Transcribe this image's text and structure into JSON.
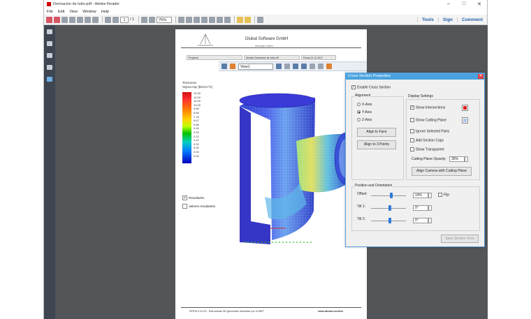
{
  "window": {
    "title": "Derivacion de tubo.pdf - Adobe Reader"
  },
  "menu": [
    "File",
    "Edit",
    "View",
    "Window",
    "Help"
  ],
  "toolbar": {
    "page_current": "1",
    "page_total": "/ 1",
    "zoom": "75%",
    "links": [
      "Tools",
      "Sign",
      "Comment"
    ]
  },
  "page": {
    "company": "Dlubal Software GmbH",
    "company_sub": "Ximoojen Vuiern",
    "info": [
      {
        "label": "Proyecto",
        "value": ""
      },
      {
        "label": "Modelo",
        "value": "Derivacion de tubo.rf5"
      },
      {
        "label": "Fecha",
        "value": "21.11.2017"
      }
    ],
    "view_select": "View1",
    "legend": {
      "title_line1": "Tensiones",
      "title_line2": "Sigma-eqv [kN/cm^2]",
      "ticks": [
        "10.00",
        "10.00",
        "10.00",
        "10.00",
        "9.89",
        "8.89",
        "7.78",
        "6.67",
        "5.56",
        "4.44",
        "3.33",
        "2.22",
        "1.11",
        "0.00",
        "0.00",
        "0.00",
        "0.00"
      ],
      "checks": [
        {
          "label": "Resultados",
          "checked": true
        },
        {
          "label": "Valores resultantes",
          "checked": false
        }
      ]
    },
    "footer_left": "RFEM 5.12.00 - Estructuras 3D generales resueltas por el MEF",
    "footer_right": "www.dlubal.com/es/"
  },
  "dialog": {
    "title": "Cross Section Properties",
    "enable_label": "Enable Cross Section",
    "enable_checked": true,
    "alignment": {
      "label": "Alignment",
      "options": [
        "X-Axis",
        "Y-Axis",
        "Z-Axis"
      ],
      "selected": "Y-Axis",
      "btn_face": "Align to Face",
      "btn_points": "Align to 3 Points"
    },
    "display": {
      "label": "Display Settings",
      "items": [
        {
          "label": "Show Intersections",
          "checked": true
        },
        {
          "label": "Show Cutting Plane",
          "checked": false
        },
        {
          "label": "Ignore Selected Parts",
          "checked": false
        },
        {
          "label": "Add Section Caps",
          "checked": false
        },
        {
          "label": "Show Transparent",
          "checked": false
        }
      ],
      "opacity_label": "Cutting Plane Opacity:",
      "opacity_value": "35%",
      "btn_camera": "Align Camera with Cutting Plane",
      "colors": {
        "intersection": "#e02020",
        "plane": "#a8c8e8"
      }
    },
    "position": {
      "label": "Position and Orientation",
      "offset_label": "Offset:",
      "offset_value": "14%",
      "offset_level": 0.14,
      "flip_label": "Flip",
      "tilt1_label": "Tilt 1:",
      "tilt1_value": "0°",
      "tilt2_label": "Tilt 2:",
      "tilt2_value": "0°"
    },
    "save_label": "Save Section View"
  }
}
